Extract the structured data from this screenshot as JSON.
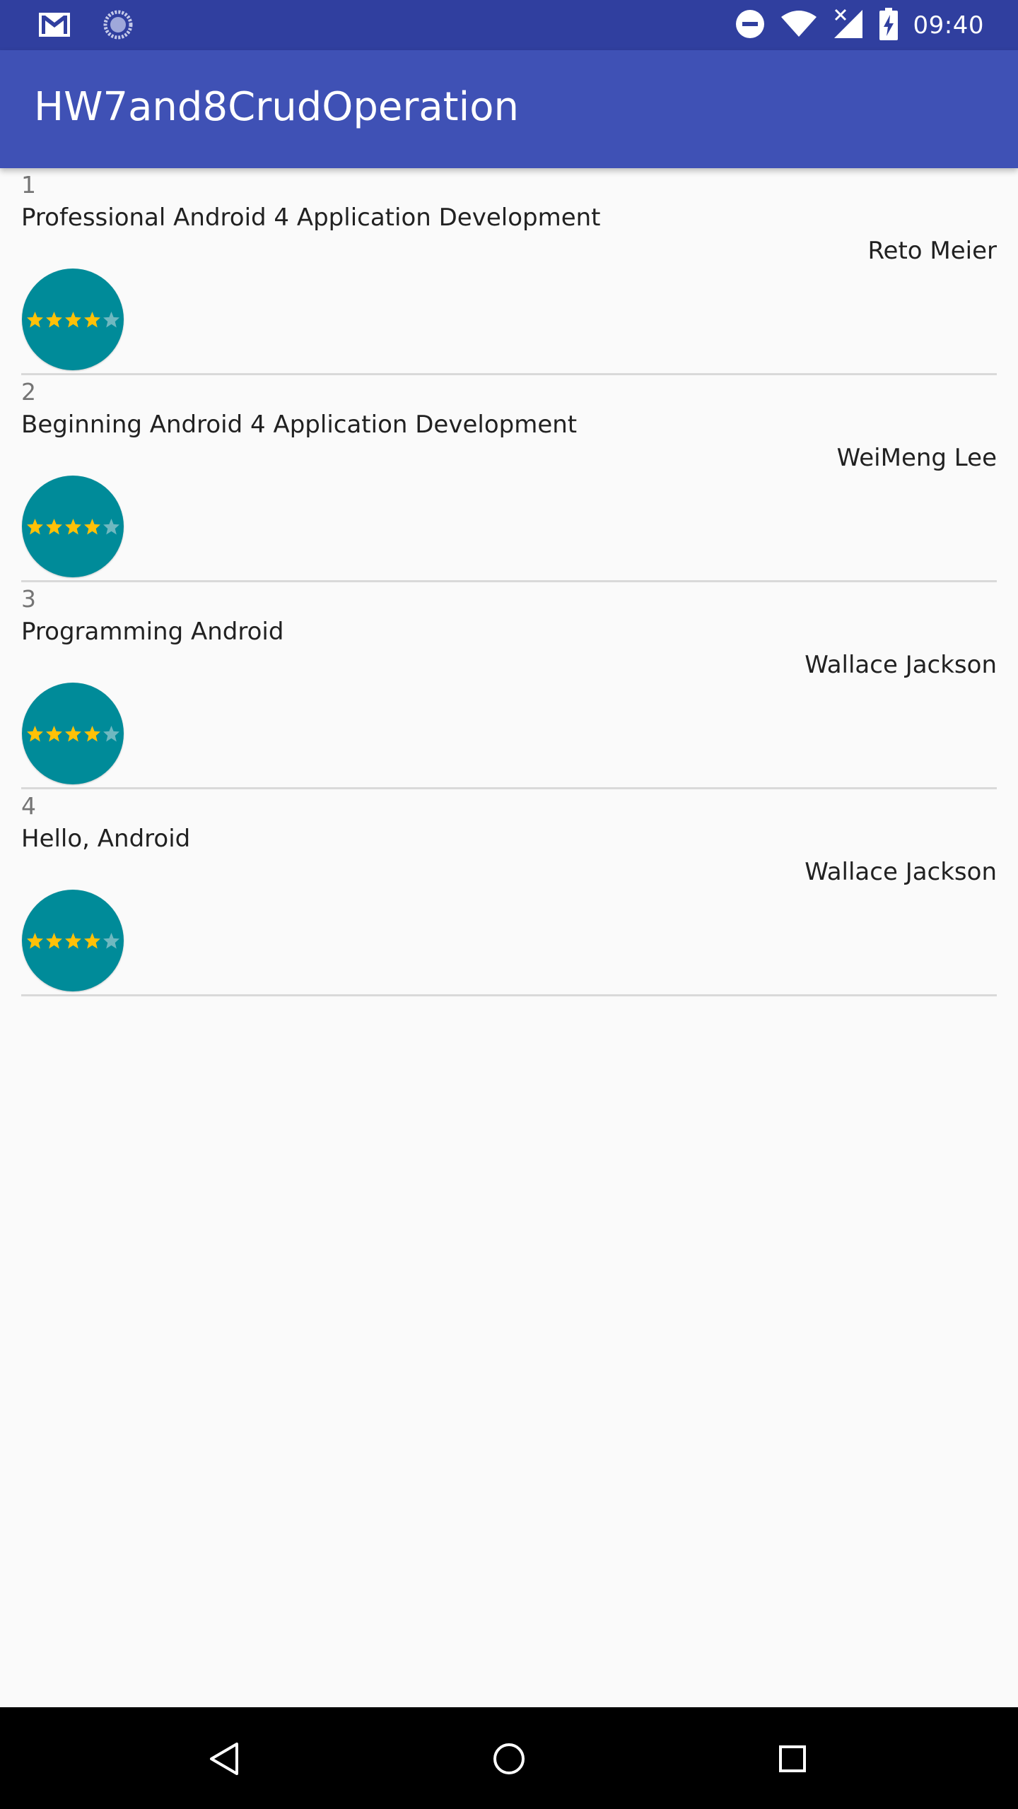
{
  "status_bar": {
    "time": "09:40",
    "icons_left": [
      "gmail-icon",
      "sync-icon"
    ],
    "icons_right": [
      "do-not-disturb-icon",
      "wifi-icon",
      "no-signal-icon",
      "battery-charging-icon"
    ]
  },
  "app_bar": {
    "title": "HW7and8CrudOperation",
    "color": "#3f51b5",
    "status_color": "#303f9f"
  },
  "books": [
    {
      "id": "1",
      "title": "Professional Android 4 Application Development",
      "author": "Reto Meier",
      "rating": 4,
      "max_rating": 5
    },
    {
      "id": "2",
      "title": "Beginning Android 4 Application Development",
      "author": "WeiMeng Lee",
      "rating": 4,
      "max_rating": 5
    },
    {
      "id": "3",
      "title": "Programming Android",
      "author": "Wallace Jackson",
      "rating": 4,
      "max_rating": 5
    },
    {
      "id": "4",
      "title": "Hello, Android",
      "author": "Wallace Jackson",
      "rating": 4,
      "max_rating": 5
    }
  ],
  "colors": {
    "avatar": "#008b99",
    "star_filled": "#ffc107",
    "star_empty": "#6fb8c0"
  },
  "nav_bar": {
    "buttons": [
      "back-icon",
      "home-icon",
      "recents-icon"
    ]
  }
}
